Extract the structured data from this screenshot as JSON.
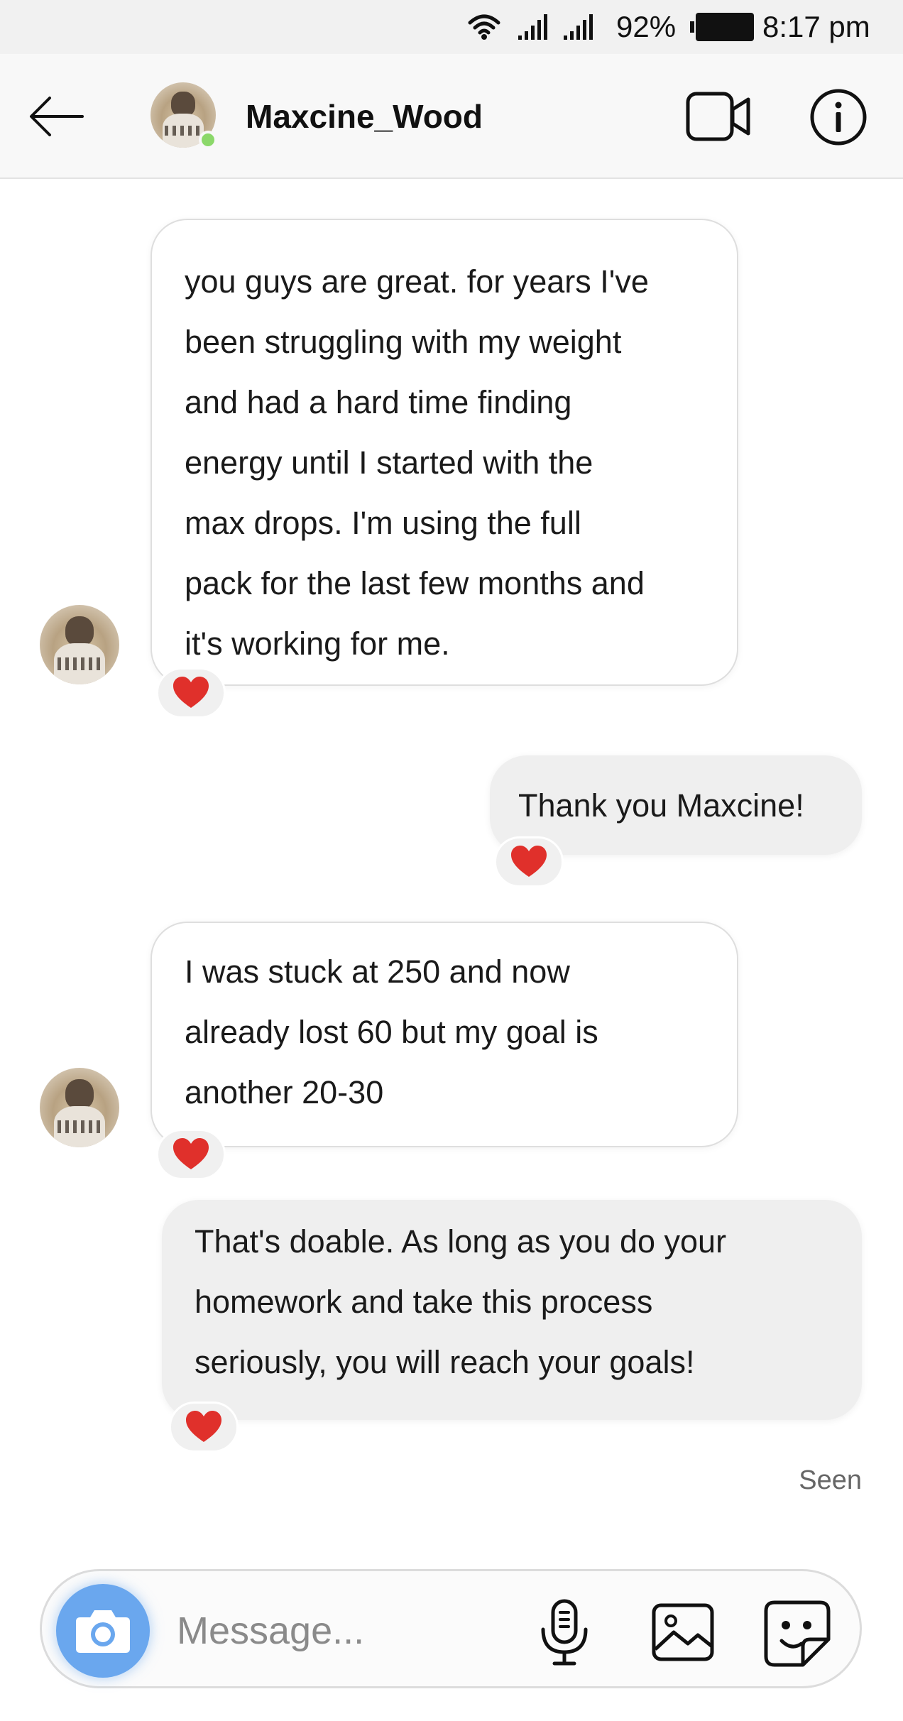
{
  "status_bar": {
    "battery_percent": "92%",
    "time": "8:17 pm",
    "icons": [
      "wifi-icon",
      "signal-icon",
      "signal-icon",
      "battery-icon"
    ]
  },
  "header": {
    "back_icon": "back-arrow-icon",
    "contact_name": "Maxcine_Wood",
    "online": true,
    "online_color": "#8bd86a",
    "video_icon": "video-call-icon",
    "info_icon": "info-icon"
  },
  "messages": [
    {
      "direction": "incoming",
      "lines": [
        "you guys are great. for years I've",
        "been struggling with my weight",
        "and had a hard time finding",
        "energy until I started with the",
        "max drops. I'm using the full",
        "pack for the last few months and",
        "it's working for me."
      ],
      "reaction": "❤️"
    },
    {
      "direction": "outgoing",
      "lines": [
        "Thank you Maxcine!"
      ],
      "reaction": "❤️"
    },
    {
      "direction": "incoming",
      "lines": [
        "I was stuck at 250 and now",
        "already lost 60 but my goal is",
        "another 20-30"
      ],
      "reaction": "❤️"
    },
    {
      "direction": "outgoing",
      "lines": [
        "That's doable. As long as you do your",
        "homework and take this process",
        "seriously, you will reach your goals!"
      ],
      "reaction": "❤️"
    }
  ],
  "seen_label": "Seen",
  "composer": {
    "placeholder": "Message...",
    "camera_icon": "camera-icon",
    "camera_color": "#6aa7ee",
    "mic_icon": "microphone-icon",
    "gallery_icon": "gallery-icon",
    "sticker_icon": "sticker-icon"
  },
  "colors": {
    "reaction_heart": "#e0302b",
    "outgoing_bubble": "#efefef",
    "incoming_bubble": "#ffffff"
  }
}
